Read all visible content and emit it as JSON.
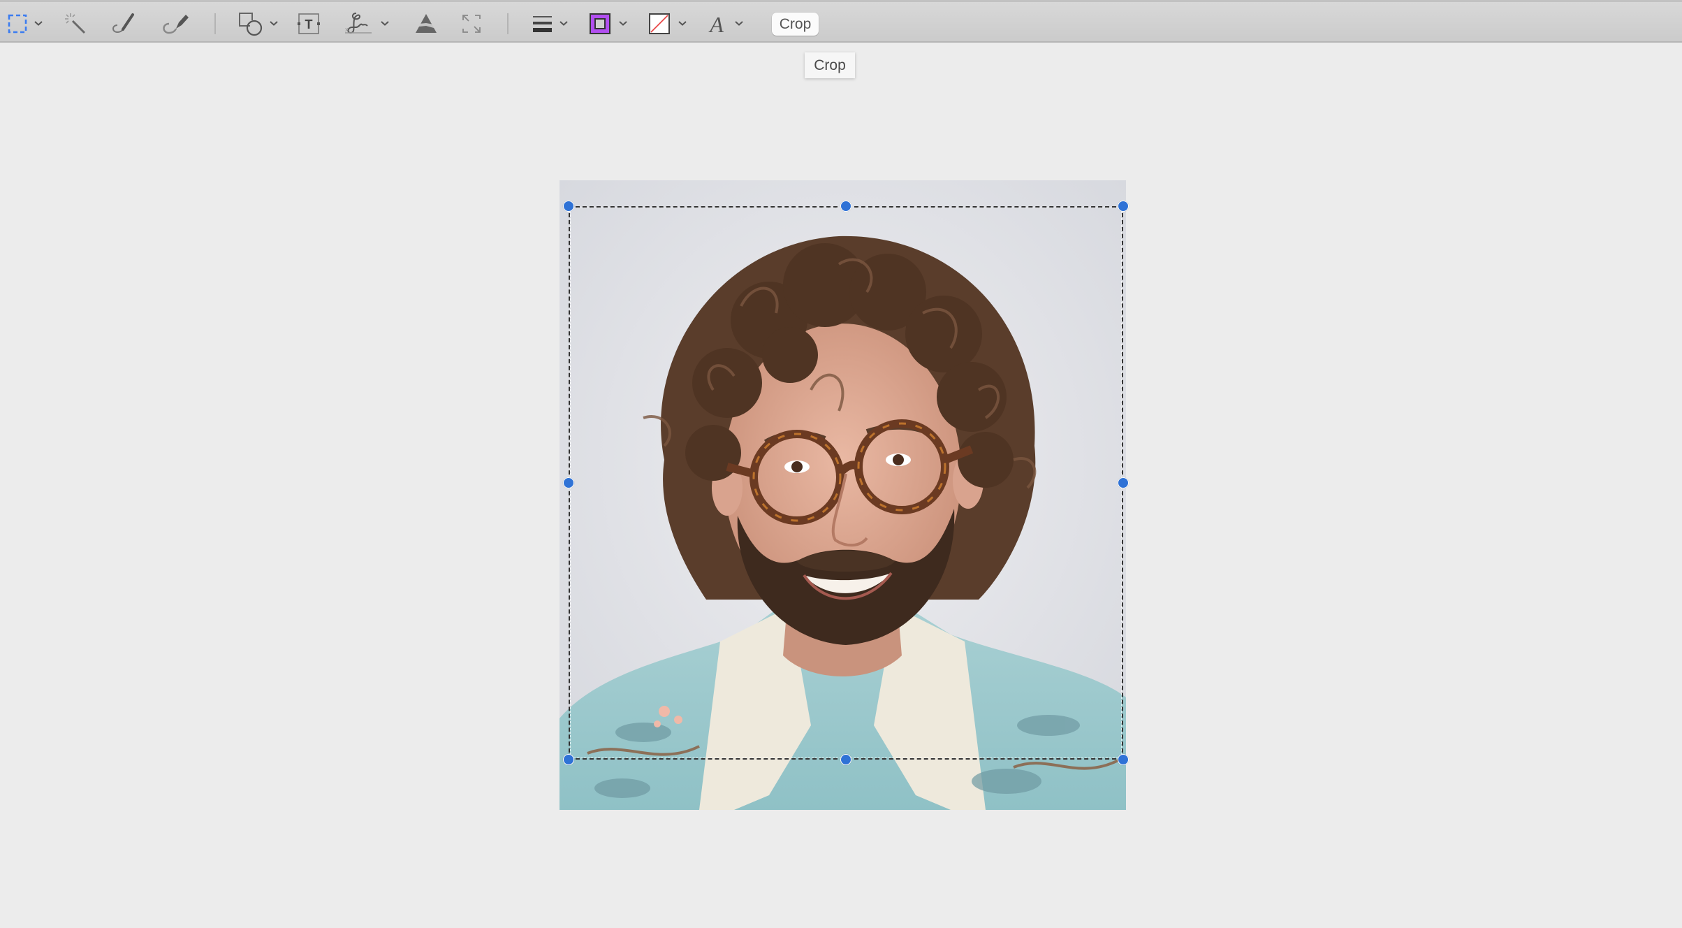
{
  "toolbar": {
    "tools": [
      {
        "name": "selection-tool",
        "icon": "dashed-rectangle-selection-icon",
        "has_menu": true
      },
      {
        "name": "instant-alpha",
        "icon": "magic-wand-icon",
        "has_menu": false
      },
      {
        "name": "sketch",
        "icon": "pen-sketch-icon",
        "has_menu": false
      },
      {
        "name": "draw",
        "icon": "marker-draw-icon",
        "has_menu": false
      },
      {
        "name": "shapes",
        "icon": "square-circle-shapes-icon",
        "has_menu": true
      },
      {
        "name": "text",
        "icon": "text-box-icon",
        "has_menu": false
      },
      {
        "name": "sign",
        "icon": "signature-icon",
        "has_menu": true
      },
      {
        "name": "adjust-color",
        "icon": "prism-icon",
        "has_menu": false
      },
      {
        "name": "adjust-size",
        "icon": "resize-arrows-icon",
        "has_menu": false
      },
      {
        "name": "shape-style",
        "icon": "line-weight-icon",
        "has_menu": true
      },
      {
        "name": "border-color",
        "icon": "border-color-swatch-icon",
        "has_menu": true,
        "color": "#b24ff0"
      },
      {
        "name": "fill-color",
        "icon": "fill-color-none-swatch-icon",
        "has_menu": true,
        "color": "#e84040"
      },
      {
        "name": "text-style",
        "icon": "font-A-icon",
        "has_menu": true
      }
    ],
    "text_tool_glyph": "T",
    "text_style_glyph": "A",
    "crop_button_label": "Crop"
  },
  "tooltip": {
    "text": "Crop"
  },
  "canvas": {
    "image": {
      "description": "Portrait photo of smiling man with curly brown hair, round tortoiseshell glasses, beard, light-blue floral shirt",
      "selection_handle_color": "#2f72d6",
      "selection_active": true
    }
  }
}
